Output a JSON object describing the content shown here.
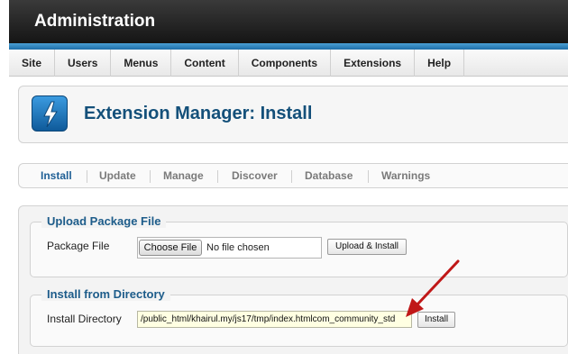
{
  "header": {
    "title": "Administration"
  },
  "menu": {
    "items": [
      {
        "label": "Site"
      },
      {
        "label": "Users"
      },
      {
        "label": "Menus"
      },
      {
        "label": "Content"
      },
      {
        "label": "Components"
      },
      {
        "label": "Extensions"
      },
      {
        "label": "Help"
      }
    ]
  },
  "page": {
    "title": "Extension Manager: Install",
    "icon": "lightning-bolt-icon"
  },
  "tabs": [
    {
      "label": "Install",
      "active": true
    },
    {
      "label": "Update"
    },
    {
      "label": "Manage"
    },
    {
      "label": "Discover"
    },
    {
      "label": "Database"
    },
    {
      "label": "Warnings"
    }
  ],
  "upload": {
    "legend": "Upload Package File",
    "field_label": "Package File",
    "choose_button": "Choose File",
    "no_file_text": "No file chosen",
    "submit_button": "Upload & Install"
  },
  "directory": {
    "legend": "Install from Directory",
    "field_label": "Install Directory",
    "value": "/public_html/khairul.my/js17/tmp/index.htmlcom_community_std",
    "submit_button": "Install"
  },
  "colors": {
    "accent": "#14507a",
    "annotation_arrow": "#c01818"
  }
}
